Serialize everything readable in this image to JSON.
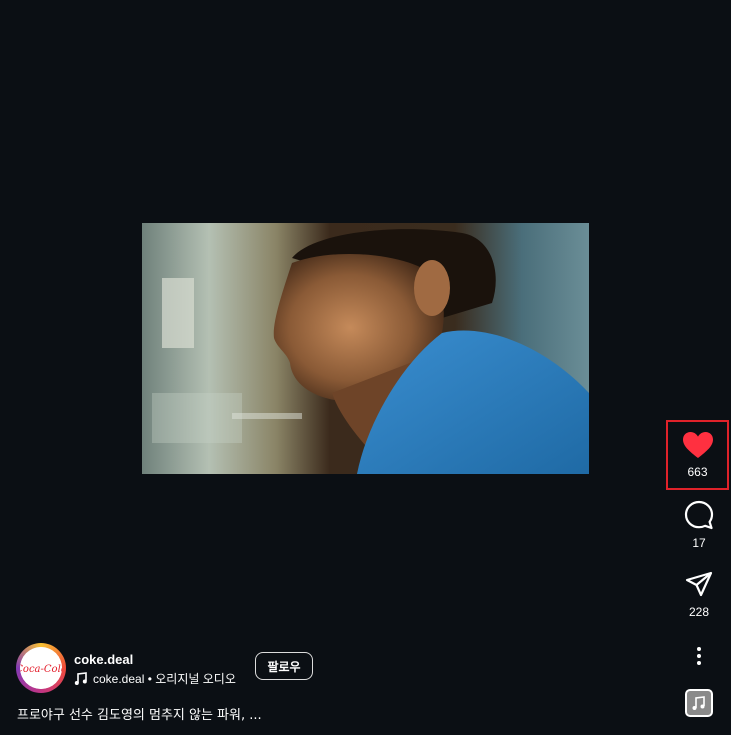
{
  "post": {
    "username": "coke.deal",
    "audio_label": "coke.deal • 오리지널 오디오",
    "follow_label": "팔로우",
    "caption": "프로야구 선수 김도영의 멈추지 않는 파워, ...",
    "avatar_brand": "Coca-Cola"
  },
  "actions": {
    "likes": "663",
    "comments": "17",
    "shares": "228"
  },
  "colors": {
    "background": "#0b0f14",
    "like_red": "#ff3040",
    "highlight_border": "#e0222a"
  },
  "icons": {
    "like": "heart-icon",
    "comment": "comment-bubble-icon",
    "share": "paper-plane-icon",
    "more": "more-vertical-icon",
    "audio": "audio-thumbnail-icon",
    "music_note": "music-note-icon"
  }
}
